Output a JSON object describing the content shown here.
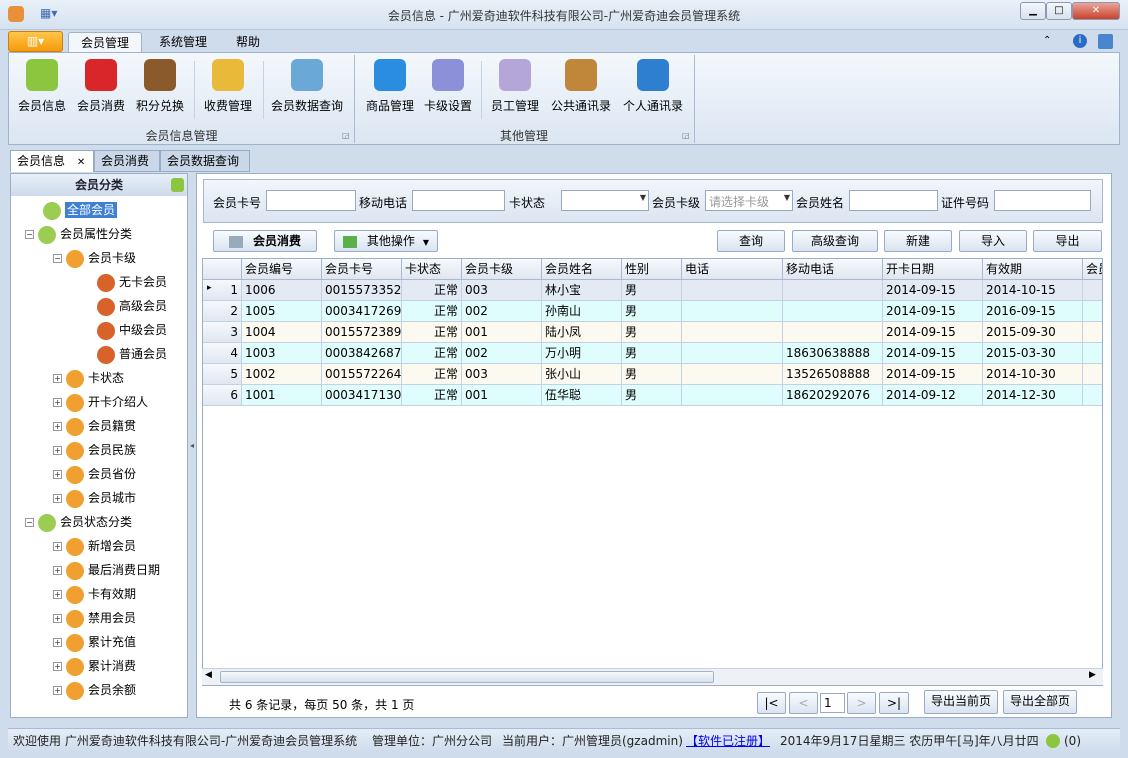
{
  "window": {
    "title": "会员信息 - 广州爱奇迪软件科技有限公司-广州爱奇迪会员管理系统",
    "minimize": "▁",
    "maximize": "□",
    "close": "✕"
  },
  "ribbon_tabs": [
    {
      "label": "会员管理",
      "active": true
    },
    {
      "label": "系统管理"
    },
    {
      "label": "帮助"
    }
  ],
  "ribbon": {
    "group1": {
      "label": "会员信息管理",
      "buttons": [
        {
          "label": "会员信息",
          "icon": "users-icon",
          "color": "#8cc63f"
        },
        {
          "label": "会员消费",
          "icon": "basket-icon",
          "color": "#d8262b"
        },
        {
          "label": "积分兑换",
          "icon": "teddy-bear-icon",
          "color": "#8b5a2b"
        },
        {
          "label": "收费管理",
          "icon": "coins-add-icon",
          "color": "#e9b93a"
        },
        {
          "label": "会员数据查询",
          "icon": "document-search-icon",
          "color": "#6aa8d8"
        }
      ]
    },
    "group2": {
      "label": "其他管理",
      "buttons": [
        {
          "label": "商品管理",
          "icon": "shapes-icon",
          "color": "#2a8de0"
        },
        {
          "label": "卡级设置",
          "icon": "id-card-icon",
          "color": "#8b90d8"
        },
        {
          "label": "员工管理",
          "icon": "staff-icon",
          "color": "#b5a6d8"
        },
        {
          "label": "公共通讯录",
          "icon": "address-book-icon",
          "color": "#c0873a"
        },
        {
          "label": "个人通讯录",
          "icon": "notebook-key-icon",
          "color": "#2f7fd0"
        }
      ]
    }
  },
  "doc_tabs": [
    {
      "label": "会员信息",
      "active": true,
      "close": "✕"
    },
    {
      "label": "会员消费"
    },
    {
      "label": "会员数据查询"
    }
  ],
  "tree": {
    "title": "会员分类",
    "nodes": [
      {
        "label": "全部会员",
        "level": 0,
        "selected": true
      },
      {
        "label": "会员属性分类",
        "level": 0,
        "expander": "−"
      },
      {
        "label": "会员卡级",
        "level": 1,
        "expander": "−"
      },
      {
        "label": "无卡会员",
        "level": 2
      },
      {
        "label": "高级会员",
        "level": 2
      },
      {
        "label": "中级会员",
        "level": 2
      },
      {
        "label": "普通会员",
        "level": 2
      },
      {
        "label": "卡状态",
        "level": 1,
        "expander": "+"
      },
      {
        "label": "开卡介绍人",
        "level": 1,
        "expander": "+"
      },
      {
        "label": "会员籍贯",
        "level": 1,
        "expander": "+"
      },
      {
        "label": "会员民族",
        "level": 1,
        "expander": "+"
      },
      {
        "label": "会员省份",
        "level": 1,
        "expander": "+"
      },
      {
        "label": "会员城市",
        "level": 1,
        "expander": "+"
      },
      {
        "label": "会员状态分类",
        "level": 0,
        "expander": "−"
      },
      {
        "label": "新增会员",
        "level": 1,
        "expander": "+"
      },
      {
        "label": "最后消费日期",
        "level": 1,
        "expander": "+"
      },
      {
        "label": "卡有效期",
        "level": 1,
        "expander": "+"
      },
      {
        "label": "禁用会员",
        "level": 1,
        "expander": "+"
      },
      {
        "label": "累计充值",
        "level": 1,
        "expander": "+"
      },
      {
        "label": "累计消费",
        "level": 1,
        "expander": "+"
      },
      {
        "label": "会员余额",
        "level": 1,
        "expander": "+"
      }
    ]
  },
  "filter": {
    "card_no_label": "会员卡号",
    "card_no": "",
    "mobile_label": "移动电话",
    "mobile": "",
    "status_label": "卡状态",
    "status": "",
    "level_label": "会员卡级",
    "level_placeholder": "请选择卡级",
    "name_label": "会员姓名",
    "name": "",
    "id_label": "证件号码",
    "id": ""
  },
  "toolbar": {
    "consume": "会员消费",
    "other": "其他操作",
    "query": "查询",
    "advanced": "高级查询",
    "new": "新建",
    "import": "导入",
    "export": "导出"
  },
  "grid": {
    "columns": [
      "会员编号",
      "会员卡号",
      "卡状态",
      "会员卡级",
      "会员姓名",
      "性别",
      "电话",
      "移动电话",
      "开卡日期",
      "有效期",
      "会员"
    ],
    "rows": [
      [
        "1",
        "1006",
        "0015573352",
        "正常",
        "003",
        "林小宝",
        "男",
        "",
        "",
        "2014-09-15",
        "2014-10-15",
        ""
      ],
      [
        "2",
        "1005",
        "0003417269",
        "正常",
        "002",
        "孙南山",
        "男",
        "",
        "",
        "2014-09-15",
        "2016-09-15",
        ""
      ],
      [
        "3",
        "1004",
        "0015572389",
        "正常",
        "001",
        "陆小凤",
        "男",
        "",
        "",
        "2014-09-15",
        "2015-09-30",
        ""
      ],
      [
        "4",
        "1003",
        "0003842687",
        "正常",
        "002",
        "万小明",
        "男",
        "",
        "18630638888",
        "2014-09-15",
        "2015-03-30",
        ""
      ],
      [
        "5",
        "1002",
        "0015572264",
        "正常",
        "003",
        "张小山",
        "男",
        "",
        "13526508888",
        "2014-09-15",
        "2014-10-30",
        ""
      ],
      [
        "6",
        "1001",
        "0003417130",
        "正常",
        "001",
        "伍华聪",
        "男",
        "",
        "18620292076",
        "2014-09-12",
        "2014-12-30",
        ""
      ]
    ]
  },
  "pager": {
    "summary": "共 6 条记录，每页 50 条，共 1 页",
    "first": "|<",
    "prev": "<",
    "page": "1",
    "next": ">",
    "last": ">|",
    "export_page": "导出当前页",
    "export_all": "导出全部页"
  },
  "statusbar": {
    "welcome": "欢迎使用 广州爱奇迪软件科技有限公司-广州爱奇迪会员管理系统",
    "unit": "管理单位：广州分公司",
    "user": "当前用户：广州管理员(gzadmin)",
    "registered": "【软件已注册】",
    "date": "2014年9月17日星期三 农历甲午[马]年八月廿四",
    "online": "(0)"
  }
}
